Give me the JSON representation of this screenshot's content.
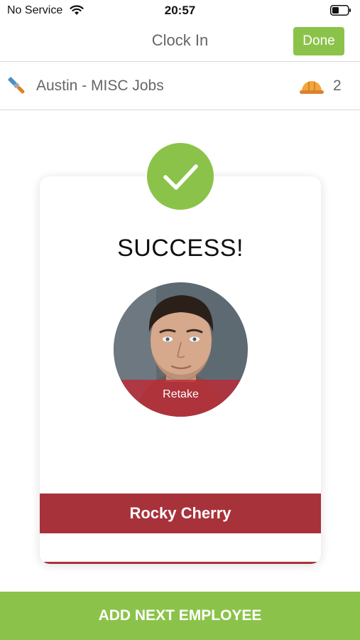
{
  "status_bar": {
    "carrier": "No Service",
    "time": "20:57",
    "wifi_icon": "wifi-icon",
    "battery_icon": "battery-icon"
  },
  "nav": {
    "title": "Clock In",
    "done_label": "Done"
  },
  "job": {
    "icon": "paint-brush-icon",
    "name": "Austin - MISC Jobs",
    "crew_icon": "hard-hat-icon",
    "crew_count": "2"
  },
  "result": {
    "icon": "check-icon",
    "title": "SUCCESS!",
    "photo": "employee-photo",
    "retake_label": "Retake",
    "employee_name": "Rocky Cherry"
  },
  "footer": {
    "add_next_label": "ADD NEXT EMPLOYEE"
  },
  "colors": {
    "accent_green": "#8bc34a",
    "banner_red": "#a8323a"
  }
}
